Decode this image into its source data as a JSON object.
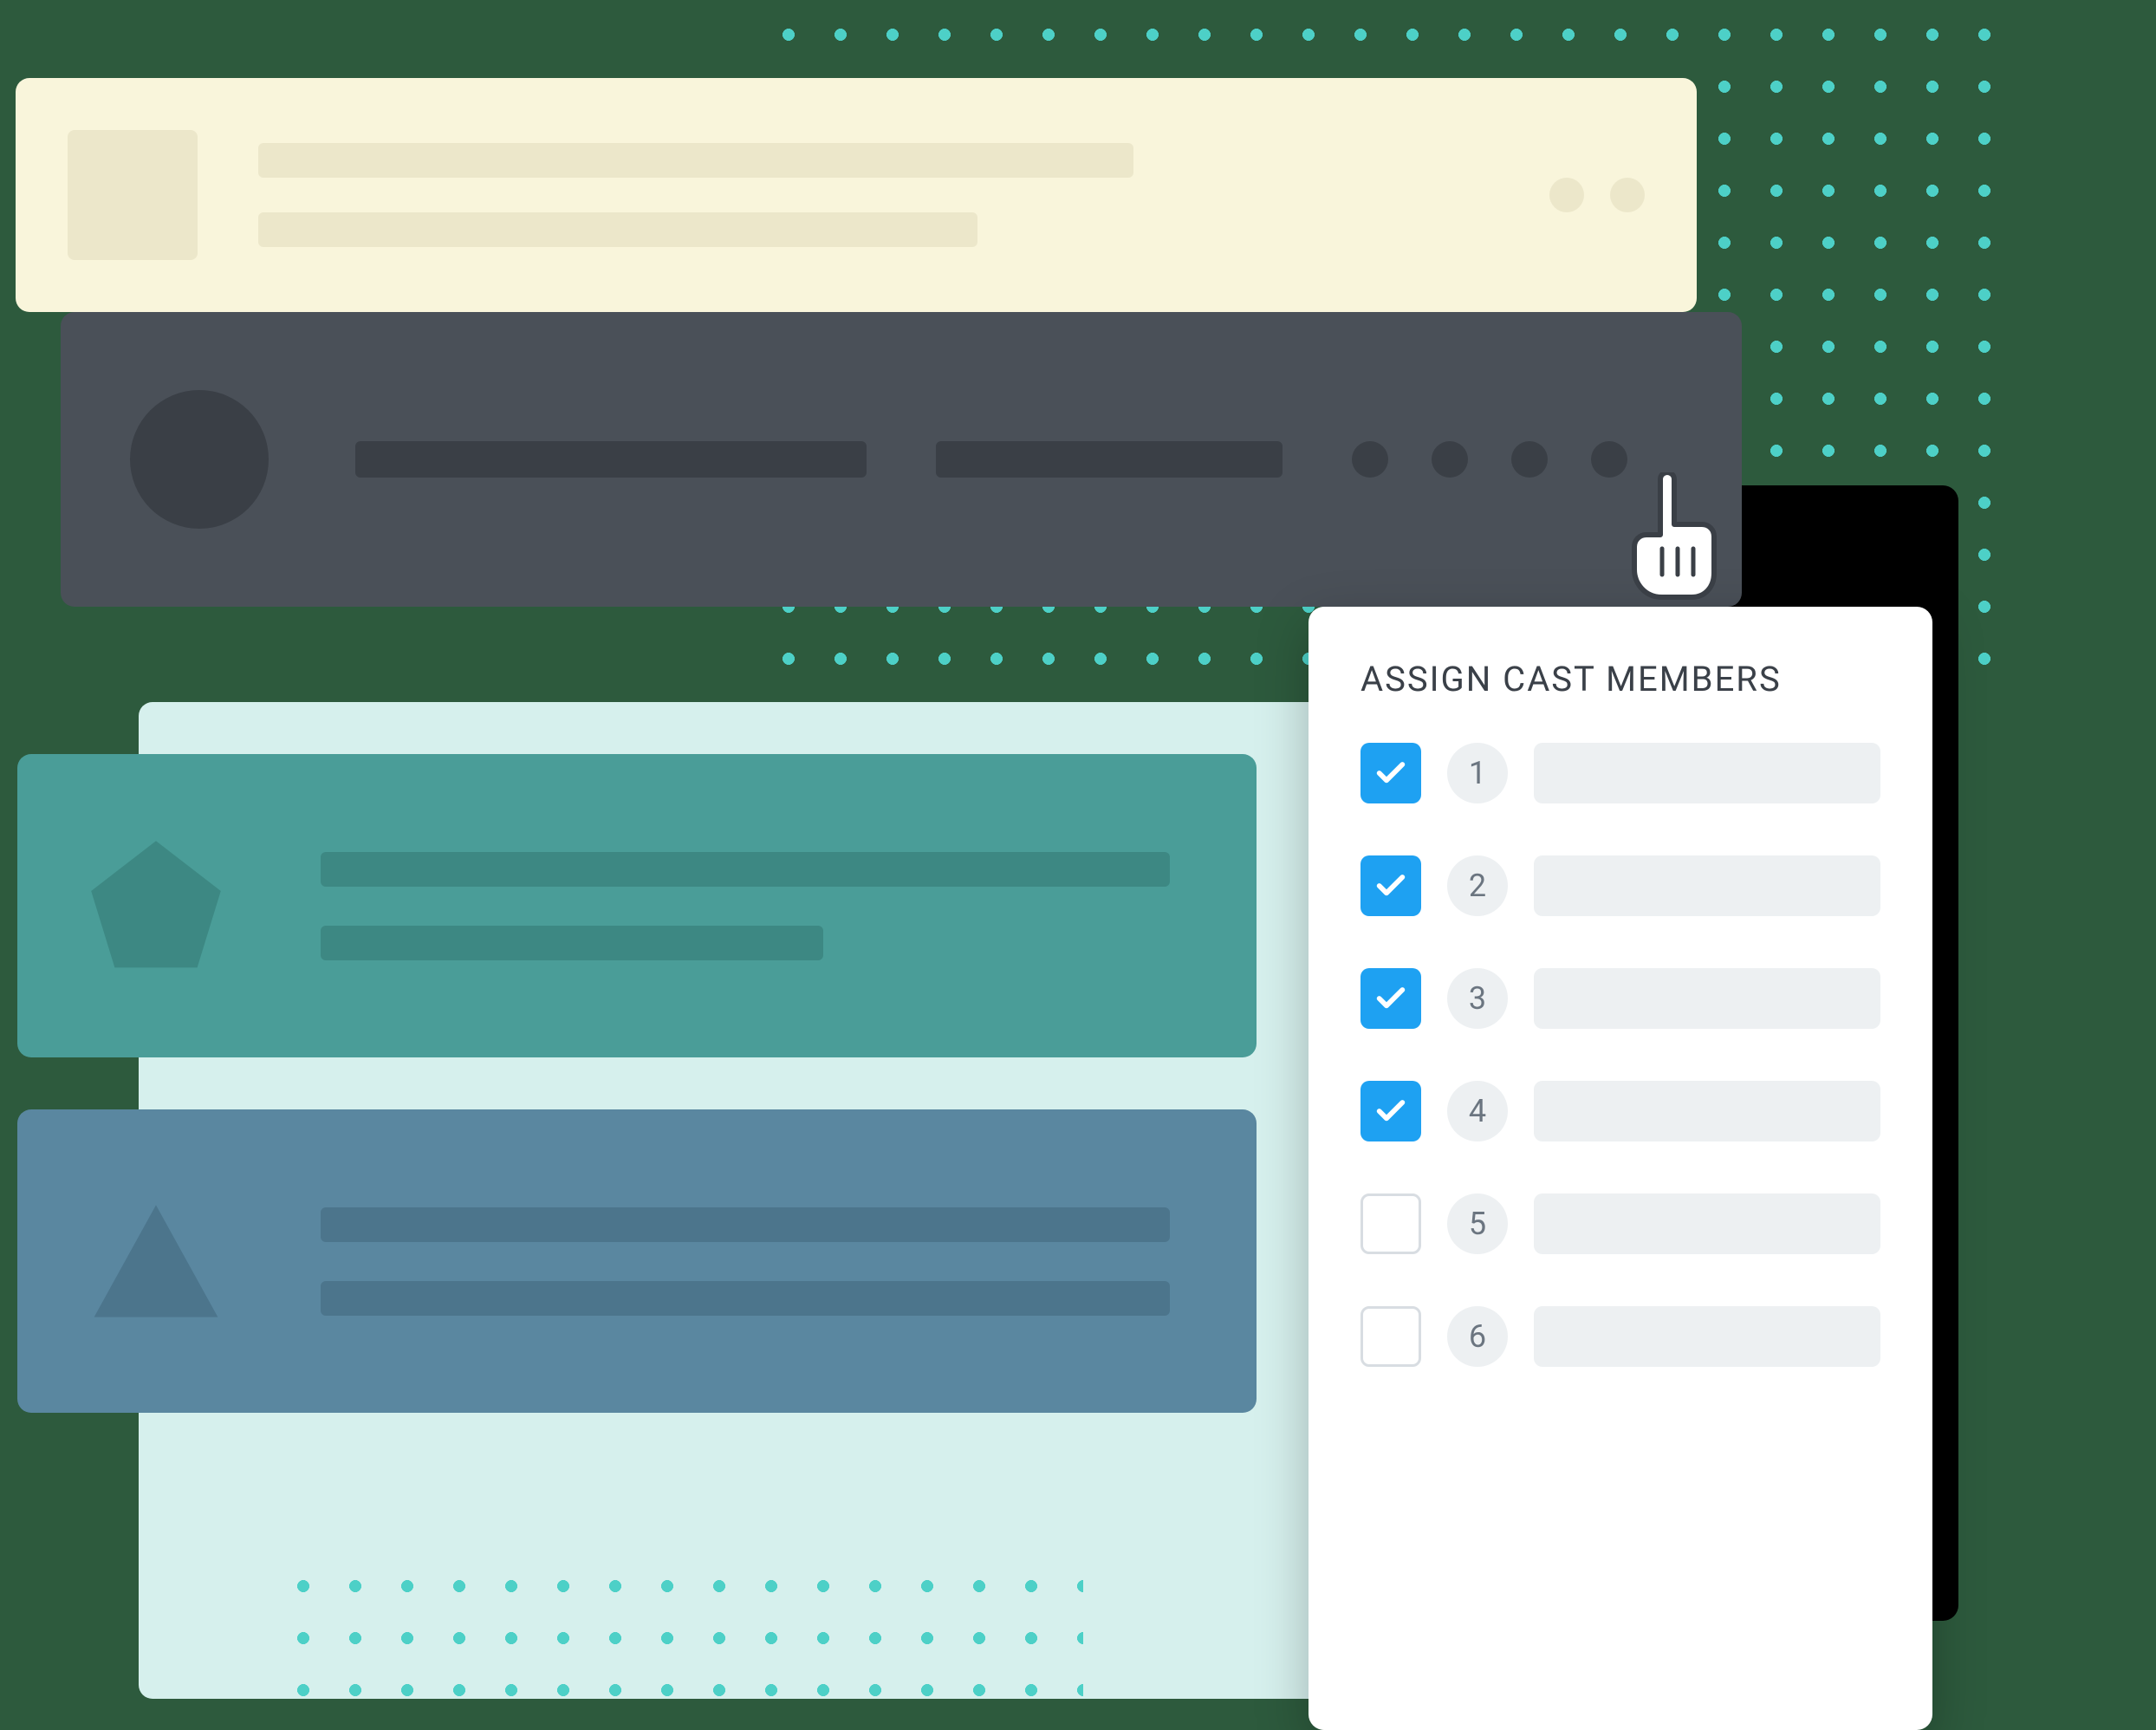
{
  "dropdown": {
    "title": "ASSIGN CAST MEMBERS",
    "members": [
      {
        "number": "1",
        "checked": true
      },
      {
        "number": "2",
        "checked": true
      },
      {
        "number": "3",
        "checked": true
      },
      {
        "number": "4",
        "checked": true
      },
      {
        "number": "5",
        "checked": false
      },
      {
        "number": "6",
        "checked": false
      }
    ]
  }
}
